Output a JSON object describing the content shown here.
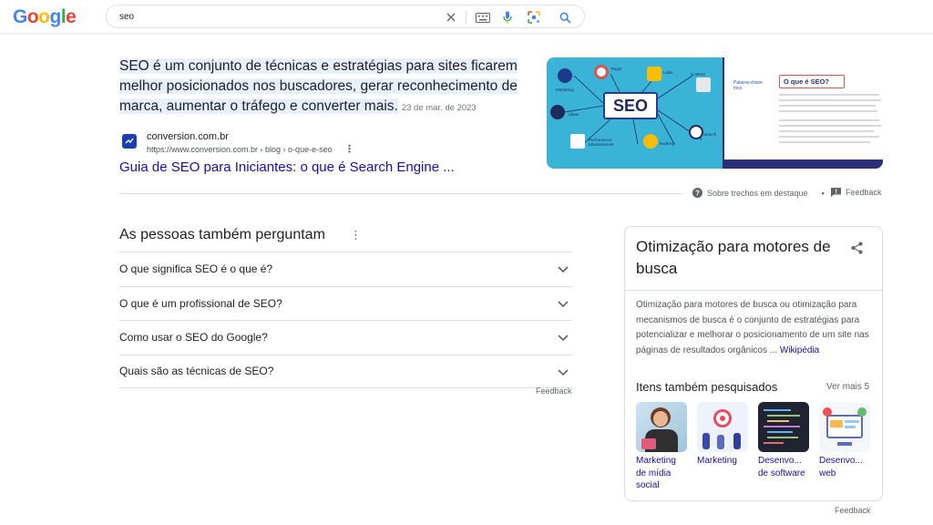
{
  "logo": {
    "letters": [
      "G",
      "o",
      "o",
      "g",
      "l",
      "e"
    ],
    "colors": [
      "#4285f4",
      "#ea4335",
      "#fbbc05",
      "#4285f4",
      "#34a853",
      "#ea4335"
    ]
  },
  "search": {
    "query": "seo",
    "icons": [
      "close-icon",
      "keyboard-icon",
      "microphone-icon",
      "lens-icon",
      "search-icon"
    ]
  },
  "featured_snippet": {
    "text": "SEO é um conjunto de técnicas e estratégias para sites ficarem melhor posicionados nos buscadores, gerar reconhecimento de marca, aumentar o tráfego e converter mais.",
    "date": "23 de mar. de 2023",
    "source_name": "conversion.com.br",
    "source_url": "https://www.conversion.com.br › blog › o-que-e-seo",
    "title": "Guia de SEO para Iniciantes: o que é Search Engine ...",
    "about_label": "Sobre trechos em destaque",
    "feedback_label": "Feedback",
    "image": {
      "left_labels": [
        "Target",
        "Links",
        "Content",
        "Marketing",
        "Ideas",
        "Performance Measurement",
        "Ranking",
        "Search"
      ],
      "center_text": "SEO",
      "right_heading": "O que é SEO?",
      "right_keyword": "Palavra-chave foco"
    }
  },
  "paa": {
    "title": "As pessoas também perguntam",
    "questions": [
      "O que significa SEO é o que é?",
      "O que é um profissional de SEO?",
      "Como usar o SEO do Google?",
      "Quais são as técnicas de SEO?"
    ],
    "feedback_label": "Feedback"
  },
  "knowledge_panel": {
    "title": "Otimização para motores de busca",
    "description": "Otimização para motores de busca ou otimização para mecanismos de busca é o conjunto de estratégias para potencializar e melhorar o posicionamento de um site nas páginas de resultados orgânicos ...",
    "source_link": "Wikipédia",
    "also_searched_title": "Itens também pesquisados",
    "see_more": "Ver mais 5",
    "items": [
      {
        "label": "Marketing de mídia social"
      },
      {
        "label": "Marketing"
      },
      {
        "label": "Desenvo... de software"
      },
      {
        "label": "Desenvo... web"
      }
    ],
    "feedback_label": "Feedback"
  }
}
